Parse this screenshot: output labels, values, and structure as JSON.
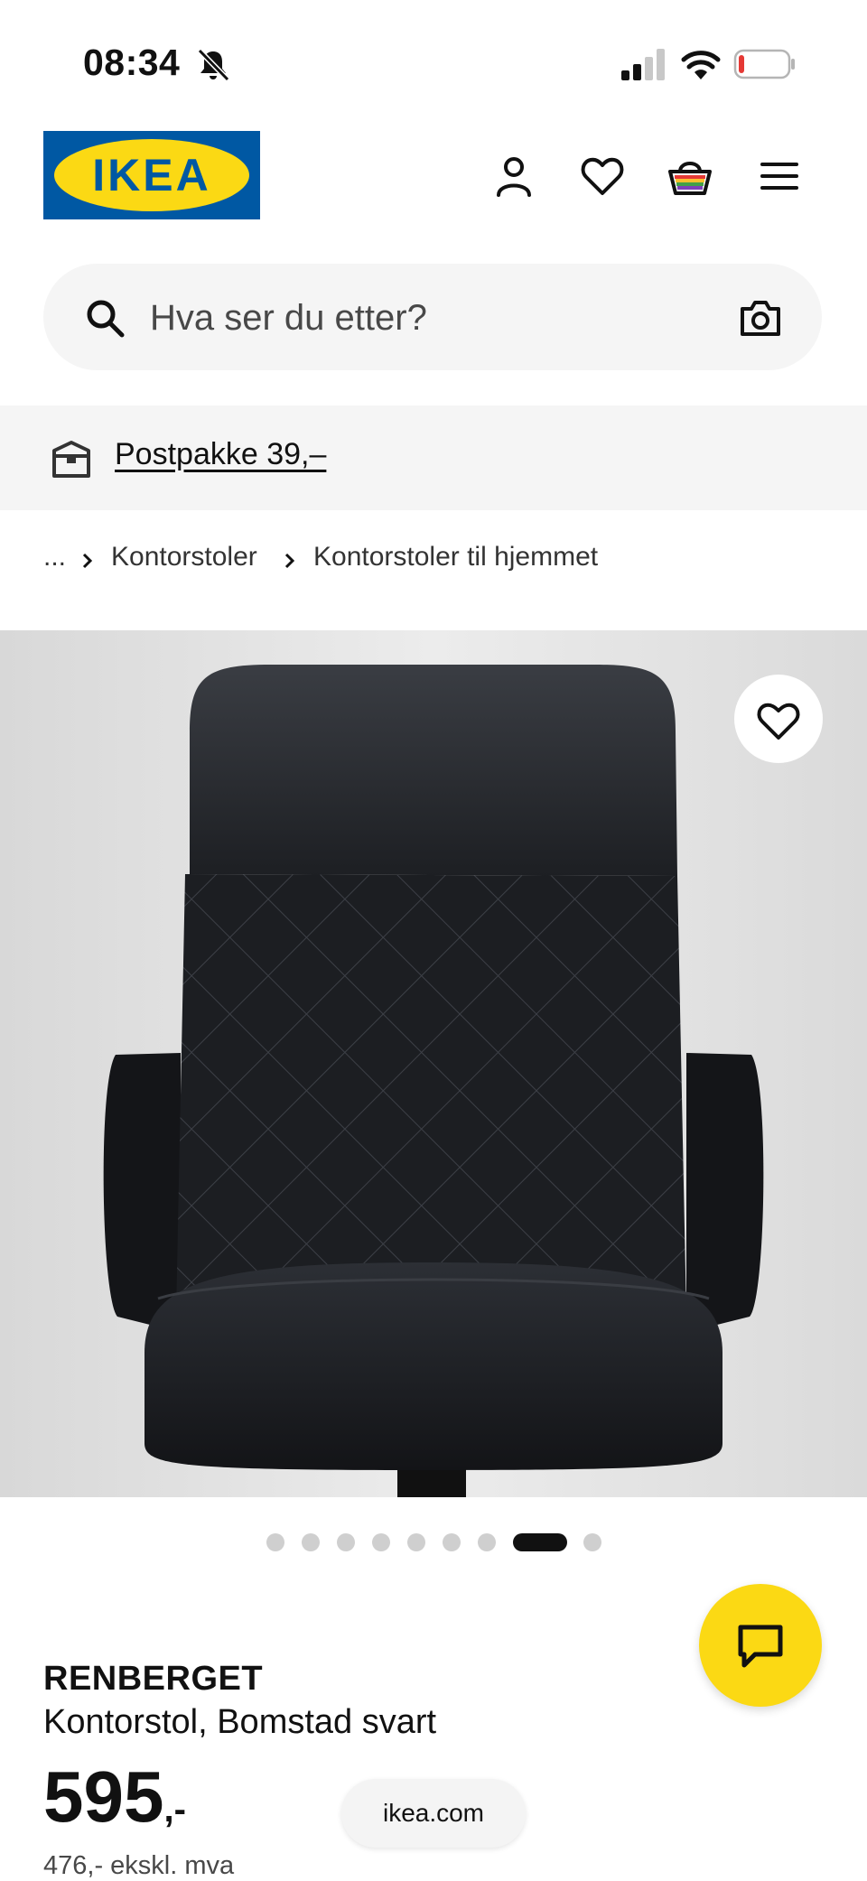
{
  "status_bar": {
    "time": "08:34"
  },
  "header": {
    "logo_text": "IKEA"
  },
  "search": {
    "placeholder": "Hva ser du etter?"
  },
  "promo": {
    "link_text": "Postpakke 39,–"
  },
  "breadcrumb": {
    "ellipsis": "...",
    "items": [
      "Kontorstoler",
      "Kontorstoler til hjemmet"
    ]
  },
  "gallery": {
    "total_images": 9,
    "active_index": 8
  },
  "product": {
    "name": "RENBERGET",
    "description": "Kontorstol, Bomstad svart",
    "price": "595",
    "price_suffix": ",-",
    "price_ex_vat": "476,- ekskl. mva"
  },
  "browser": {
    "url": "ikea.com"
  },
  "colors": {
    "ikea_blue": "#0058a3",
    "ikea_yellow": "#fbd914",
    "chat_yellow": "#fbd914"
  }
}
